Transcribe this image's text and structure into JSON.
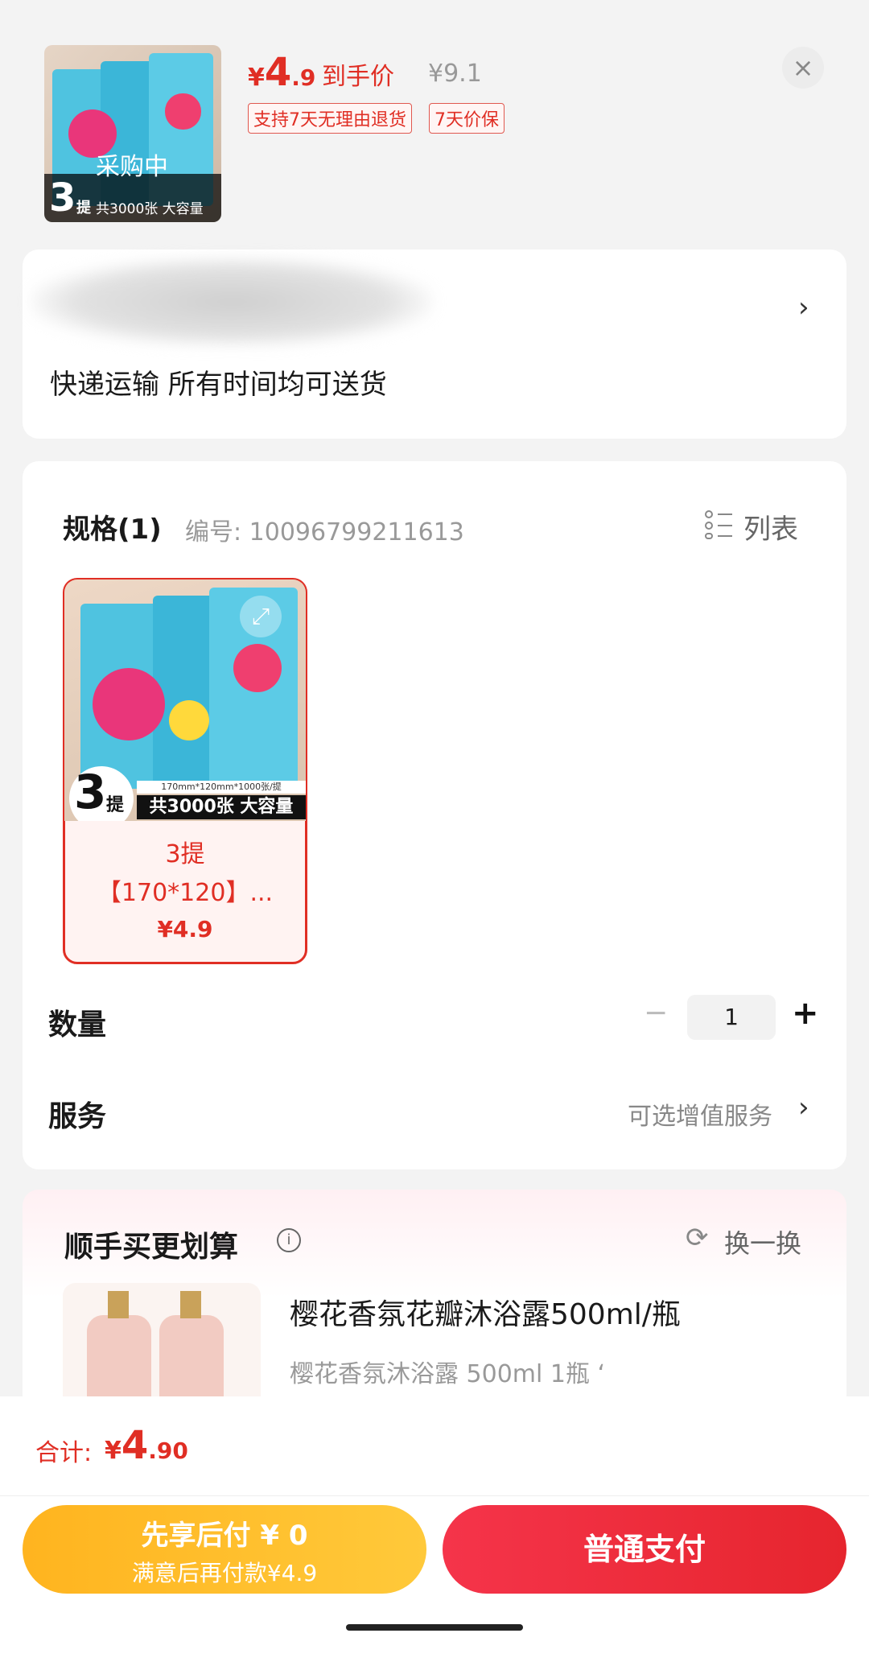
{
  "header": {
    "thumb_count": "3",
    "thumb_unit": "提",
    "thumb_status": "采购中",
    "thumb_caption": "共3000张 大容量",
    "price_symbol": "¥",
    "price_int": "4",
    "price_dec": ".9",
    "price_label": "到手价",
    "original_price": "¥9.1",
    "tags": [
      "支持7天无理由退货",
      "7天价保"
    ],
    "close_icon": "×"
  },
  "address": {
    "delivery_text": "快递运输 所有时间均可送货",
    "chevron": "›"
  },
  "spec": {
    "title": "规格(1)",
    "code_label": "编号: 10096799211613",
    "list_label": "列表",
    "option": {
      "big_num": "3",
      "unit": "提",
      "size_line": "170mm*120mm*1000张/提",
      "banner": "共3000张 大容量",
      "name_line1": "3提",
      "name_line2": "【170*120】...",
      "price": "¥4.9"
    }
  },
  "quantity": {
    "label": "数量",
    "minus": "−",
    "value": "1",
    "plus": "+"
  },
  "service": {
    "label": "服务",
    "value": "可选增值服务",
    "chevron": "›"
  },
  "bundle": {
    "title": "顺手买更划算",
    "info_icon": "i",
    "refresh_label": "换一换",
    "item_title": "樱花香氛花瓣沐浴露500ml/瓶",
    "item_sub": "樱花香氛沐浴露 500ml 1瓶 ‘"
  },
  "footer": {
    "total_label": "合计:",
    "total_symbol": "¥",
    "total_int": "4",
    "total_dec": ".90",
    "paylater_title": "先享后付 ¥ 0",
    "paylater_sub": "满意后再付款¥4.9",
    "pay_button": "普通支付"
  },
  "colors": {
    "accent_red": "#e02e24",
    "button_yellow": "#ffb41f",
    "button_red": "#eb2a3a"
  }
}
